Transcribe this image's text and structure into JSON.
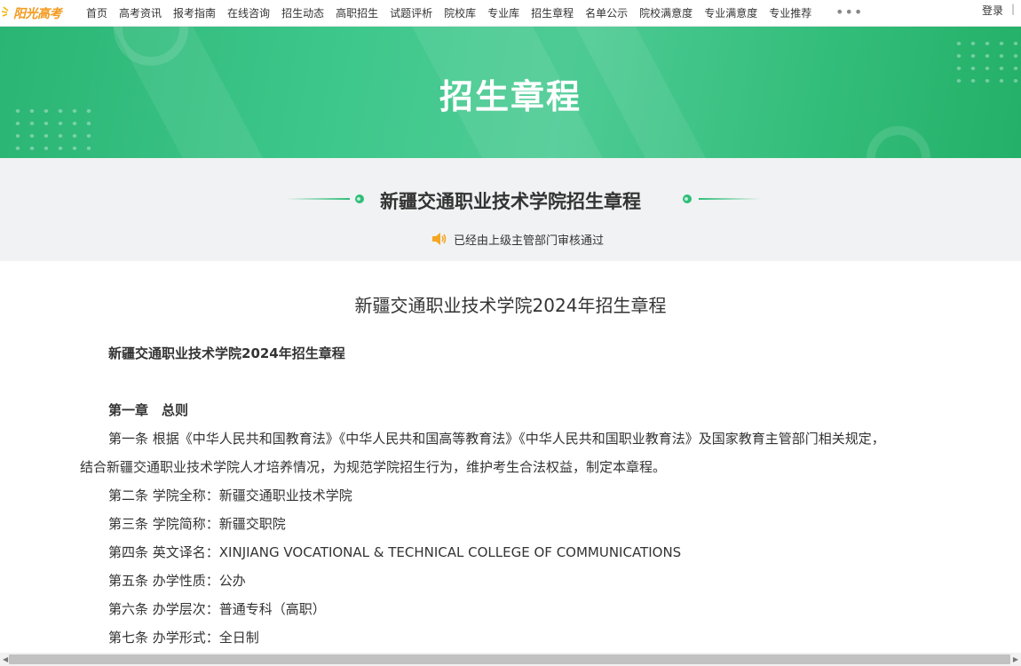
{
  "logo": {
    "text": "阳光高考"
  },
  "nav": {
    "items": [
      "首页",
      "高考资讯",
      "报考指南",
      "在线咨询",
      "招生动态",
      "高职招生",
      "试题评析",
      "院校库",
      "专业库",
      "招生章程",
      "名单公示",
      "院校满意度",
      "专业满意度",
      "专业推荐"
    ],
    "more": "•••",
    "login": "登录",
    "separator": "|"
  },
  "banner": {
    "title": "招生章程"
  },
  "band": {
    "title": "新疆交通职业技术学院招生章程",
    "notice": "已经由上级主管部门审核通过"
  },
  "article": {
    "title": "新疆交通职业技术学院2024年招生章程",
    "heading": "新疆交通职业技术学院2024年招生章程",
    "chapter": "第一章　总则",
    "art1_line1": "第一条  根据《中华人民共和国教育法》《中华人民共和国高等教育法》《中华人民共和国职业教育法》及国家教育主管部门相关规定，",
    "art1_line2": "结合新疆交通职业技术学院人才培养情况，为规范学院招生行为，维护考生合法权益，制定本章程。",
    "art2": "第二条  学院全称：新疆交通职业技术学院",
    "art3": "第三条  学院简称：新疆交职院",
    "art4": "第四条  英文译名：XINJIANG VOCATIONAL & TECHNICAL COLLEGE OF COMMUNICATIONS",
    "art5": "第五条  办学性质：公办",
    "art6": "第六条  办学层次：普通专科（高职）",
    "art7": "第七条  办学形式：全日制"
  },
  "colors": {
    "brand_green": "#2ebe78",
    "logo_orange": "#f29a1e",
    "speaker_orange": "#f5a623"
  },
  "icons": {
    "logo": "sun-icon",
    "notice": "speaker-icon"
  }
}
